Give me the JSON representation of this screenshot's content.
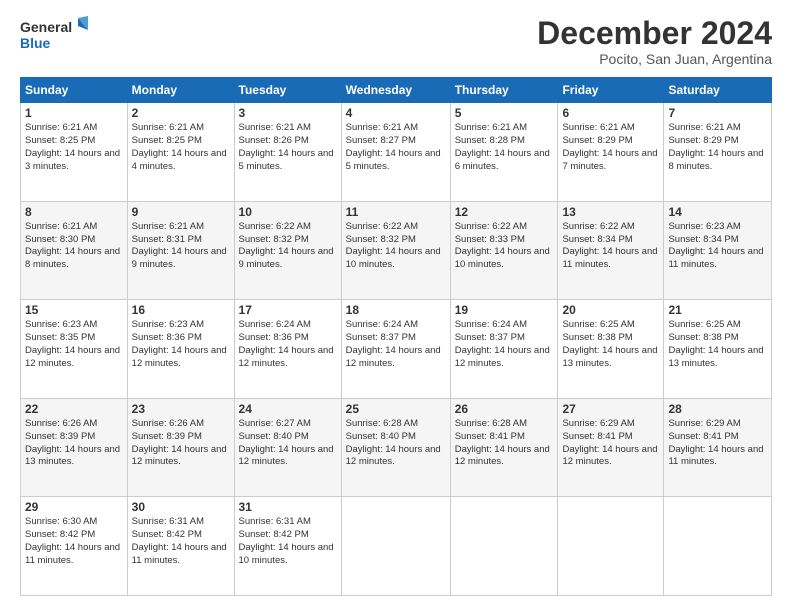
{
  "logo": {
    "line1": "General",
    "line2": "Blue"
  },
  "header": {
    "month": "December 2024",
    "location": "Pocito, San Juan, Argentina"
  },
  "days_of_week": [
    "Sunday",
    "Monday",
    "Tuesday",
    "Wednesday",
    "Thursday",
    "Friday",
    "Saturday"
  ],
  "weeks": [
    [
      {
        "day": "1",
        "sunrise": "6:21 AM",
        "sunset": "8:25 PM",
        "daylight": "14 hours and 3 minutes."
      },
      {
        "day": "2",
        "sunrise": "6:21 AM",
        "sunset": "8:25 PM",
        "daylight": "14 hours and 4 minutes."
      },
      {
        "day": "3",
        "sunrise": "6:21 AM",
        "sunset": "8:26 PM",
        "daylight": "14 hours and 5 minutes."
      },
      {
        "day": "4",
        "sunrise": "6:21 AM",
        "sunset": "8:27 PM",
        "daylight": "14 hours and 5 minutes."
      },
      {
        "day": "5",
        "sunrise": "6:21 AM",
        "sunset": "8:28 PM",
        "daylight": "14 hours and 6 minutes."
      },
      {
        "day": "6",
        "sunrise": "6:21 AM",
        "sunset": "8:29 PM",
        "daylight": "14 hours and 7 minutes."
      },
      {
        "day": "7",
        "sunrise": "6:21 AM",
        "sunset": "8:29 PM",
        "daylight": "14 hours and 8 minutes."
      }
    ],
    [
      {
        "day": "8",
        "sunrise": "6:21 AM",
        "sunset": "8:30 PM",
        "daylight": "14 hours and 8 minutes."
      },
      {
        "day": "9",
        "sunrise": "6:21 AM",
        "sunset": "8:31 PM",
        "daylight": "14 hours and 9 minutes."
      },
      {
        "day": "10",
        "sunrise": "6:22 AM",
        "sunset": "8:32 PM",
        "daylight": "14 hours and 9 minutes."
      },
      {
        "day": "11",
        "sunrise": "6:22 AM",
        "sunset": "8:32 PM",
        "daylight": "14 hours and 10 minutes."
      },
      {
        "day": "12",
        "sunrise": "6:22 AM",
        "sunset": "8:33 PM",
        "daylight": "14 hours and 10 minutes."
      },
      {
        "day": "13",
        "sunrise": "6:22 AM",
        "sunset": "8:34 PM",
        "daylight": "14 hours and 11 minutes."
      },
      {
        "day": "14",
        "sunrise": "6:23 AM",
        "sunset": "8:34 PM",
        "daylight": "14 hours and 11 minutes."
      }
    ],
    [
      {
        "day": "15",
        "sunrise": "6:23 AM",
        "sunset": "8:35 PM",
        "daylight": "14 hours and 12 minutes."
      },
      {
        "day": "16",
        "sunrise": "6:23 AM",
        "sunset": "8:36 PM",
        "daylight": "14 hours and 12 minutes."
      },
      {
        "day": "17",
        "sunrise": "6:24 AM",
        "sunset": "8:36 PM",
        "daylight": "14 hours and 12 minutes."
      },
      {
        "day": "18",
        "sunrise": "6:24 AM",
        "sunset": "8:37 PM",
        "daylight": "14 hours and 12 minutes."
      },
      {
        "day": "19",
        "sunrise": "6:24 AM",
        "sunset": "8:37 PM",
        "daylight": "14 hours and 12 minutes."
      },
      {
        "day": "20",
        "sunrise": "6:25 AM",
        "sunset": "8:38 PM",
        "daylight": "14 hours and 13 minutes."
      },
      {
        "day": "21",
        "sunrise": "6:25 AM",
        "sunset": "8:38 PM",
        "daylight": "14 hours and 13 minutes."
      }
    ],
    [
      {
        "day": "22",
        "sunrise": "6:26 AM",
        "sunset": "8:39 PM",
        "daylight": "14 hours and 13 minutes."
      },
      {
        "day": "23",
        "sunrise": "6:26 AM",
        "sunset": "8:39 PM",
        "daylight": "14 hours and 12 minutes."
      },
      {
        "day": "24",
        "sunrise": "6:27 AM",
        "sunset": "8:40 PM",
        "daylight": "14 hours and 12 minutes."
      },
      {
        "day": "25",
        "sunrise": "6:28 AM",
        "sunset": "8:40 PM",
        "daylight": "14 hours and 12 minutes."
      },
      {
        "day": "26",
        "sunrise": "6:28 AM",
        "sunset": "8:41 PM",
        "daylight": "14 hours and 12 minutes."
      },
      {
        "day": "27",
        "sunrise": "6:29 AM",
        "sunset": "8:41 PM",
        "daylight": "14 hours and 12 minutes."
      },
      {
        "day": "28",
        "sunrise": "6:29 AM",
        "sunset": "8:41 PM",
        "daylight": "14 hours and 11 minutes."
      }
    ],
    [
      {
        "day": "29",
        "sunrise": "6:30 AM",
        "sunset": "8:42 PM",
        "daylight": "14 hours and 11 minutes."
      },
      {
        "day": "30",
        "sunrise": "6:31 AM",
        "sunset": "8:42 PM",
        "daylight": "14 hours and 11 minutes."
      },
      {
        "day": "31",
        "sunrise": "6:31 AM",
        "sunset": "8:42 PM",
        "daylight": "14 hours and 10 minutes."
      },
      null,
      null,
      null,
      null
    ]
  ]
}
